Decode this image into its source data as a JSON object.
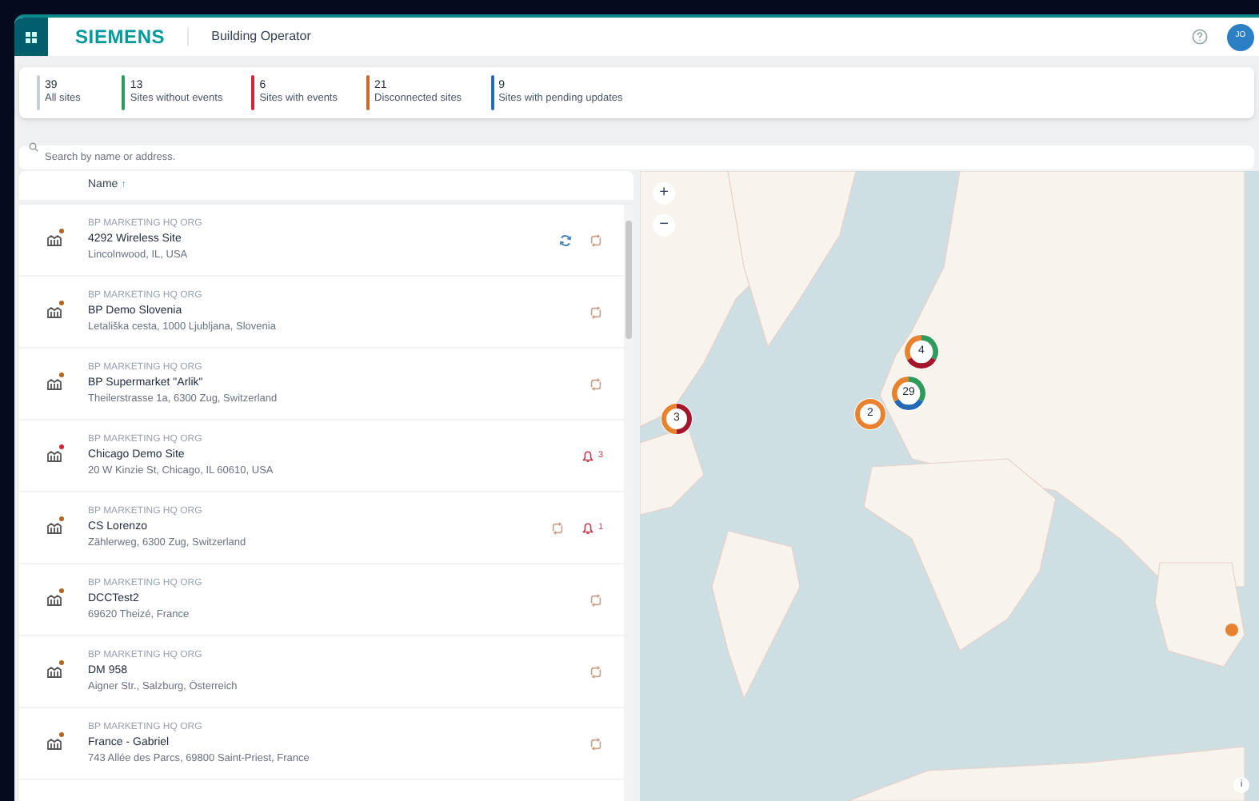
{
  "header": {
    "brand": "SIEMENS",
    "app_name": "Building Operator",
    "avatar_initials": "JO"
  },
  "stats": [
    {
      "count": "39",
      "label": "All sites",
      "color": "#c8cdd2"
    },
    {
      "count": "13",
      "label": "Sites without events",
      "color": "#2e9b5a"
    },
    {
      "count": "6",
      "label": "Sites with events",
      "color": "#d72339"
    },
    {
      "count": "21",
      "label": "Disconnected sites",
      "color": "#c86a2b"
    },
    {
      "count": "9",
      "label": "Sites with pending updates",
      "color": "#2469b8"
    }
  ],
  "search": {
    "placeholder": "Search by name or address."
  },
  "table": {
    "columns": [
      {
        "label": "Name",
        "sort_icon": "↑"
      }
    ],
    "rows": [
      {
        "org": "BP MARKETING HQ ORG",
        "name": "4292 Wireless Site",
        "address": "Lincolnwood, IL, USA",
        "color": "#b5651d",
        "actions": [
          {
            "kind": "refresh"
          },
          {
            "kind": "pending"
          }
        ]
      },
      {
        "org": "BP MARKETING HQ ORG",
        "name": "BP Demo Slovenia",
        "address": "Letališka cesta, 1000 Ljubljana, Slovenia",
        "color": "#b5651d",
        "actions": [
          {
            "kind": "pending"
          }
        ]
      },
      {
        "org": "BP MARKETING HQ ORG",
        "name": "BP Supermarket \"Arlik\"",
        "address": "Theilerstrasse 1a, 6300 Zug, Switzerland",
        "color": "#b5651d",
        "actions": [
          {
            "kind": "pending"
          }
        ]
      },
      {
        "org": "BP MARKETING HQ ORG",
        "name": "Chicago Demo Site",
        "address": "20 W Kinzie St, Chicago, IL 60610, USA",
        "color": "#d72339",
        "actions": [
          {
            "kind": "alarm",
            "count": "3"
          }
        ]
      },
      {
        "org": "BP MARKETING HQ ORG",
        "name": "CS Lorenzo",
        "address": "Zählerweg, 6300 Zug, Switzerland",
        "color": "#b5651d",
        "actions": [
          {
            "kind": "pending"
          },
          {
            "kind": "alarm",
            "count": "1"
          }
        ]
      },
      {
        "org": "BP MARKETING HQ ORG",
        "name": "DCCTest2",
        "address": "69620 Theizé, France",
        "color": "#b5651d",
        "actions": [
          {
            "kind": "pending"
          }
        ]
      },
      {
        "org": "BP MARKETING HQ ORG",
        "name": "DM 958",
        "address": "Aigner Str., Salzburg, Österreich",
        "color": "#b5651d",
        "actions": [
          {
            "kind": "pending"
          }
        ]
      },
      {
        "org": "BP MARKETING HQ ORG",
        "name": "France - Gabriel",
        "address": "743 Allée des Parcs, 69800 Saint-Priest, France",
        "color": "#b5651d",
        "actions": [
          {
            "kind": "pending"
          }
        ]
      }
    ]
  },
  "map": {
    "zoom_in": "+",
    "zoom_out": "−",
    "info": "i",
    "markers": [
      {
        "count": "4",
        "segments": [
          {
            "color": "#2e9b5a"
          },
          {
            "color": "#a3162c"
          },
          {
            "color": "#e8822e"
          }
        ]
      },
      {
        "count": "29",
        "segments": [
          {
            "color": "#2e9b5a"
          },
          {
            "color": "#2469b8"
          },
          {
            "color": "#e8822e"
          }
        ]
      },
      {
        "count": "3",
        "segments": [
          {
            "color": "#a3162c"
          },
          {
            "color": "#e8822e"
          }
        ]
      },
      {
        "count": "2",
        "segments": [
          {
            "color": "#e8822e"
          }
        ]
      },
      {
        "kind": "dot",
        "color": "#e8822e"
      }
    ]
  }
}
